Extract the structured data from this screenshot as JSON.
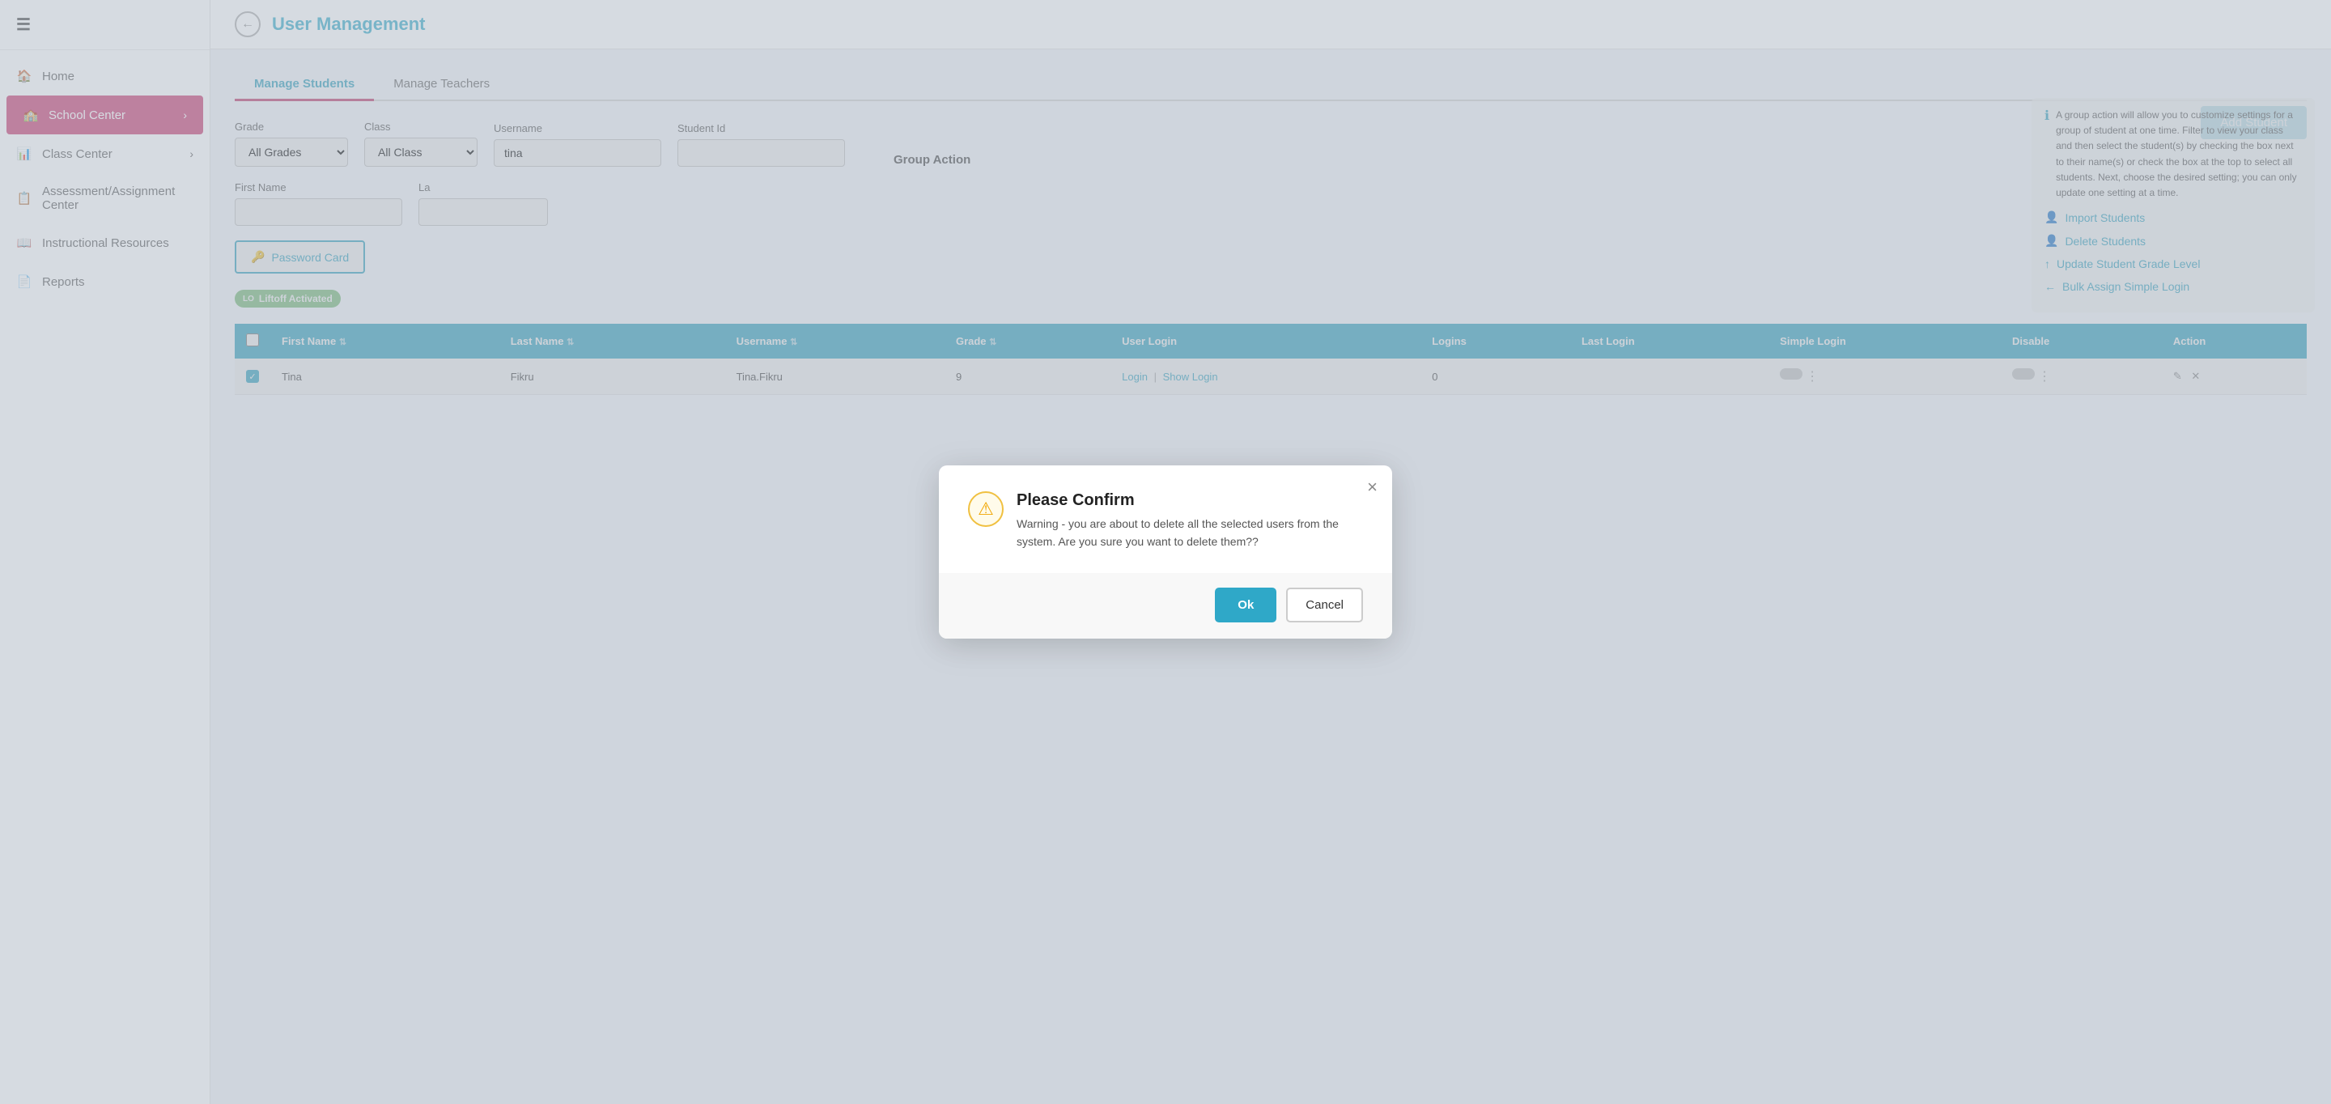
{
  "sidebar": {
    "items": [
      {
        "id": "home",
        "label": "Home",
        "icon": "🏠",
        "active": false
      },
      {
        "id": "school-center",
        "label": "School Center",
        "icon": "🏫",
        "active": true,
        "hasChevron": true
      },
      {
        "id": "class-center",
        "label": "Class Center",
        "icon": "📊",
        "active": false,
        "hasChevron": true
      },
      {
        "id": "assessment",
        "label": "Assessment/Assignment Center",
        "icon": "📋",
        "active": false
      },
      {
        "id": "instructional-resources",
        "label": "Instructional Resources",
        "icon": "📖",
        "active": false
      },
      {
        "id": "reports",
        "label": "Reports",
        "icon": "📄",
        "active": false
      }
    ]
  },
  "page": {
    "title": "User Management",
    "back_label": "←"
  },
  "tabs": [
    {
      "id": "manage-students",
      "label": "Manage Students",
      "active": true
    },
    {
      "id": "manage-teachers",
      "label": "Manage Teachers",
      "active": false
    }
  ],
  "add_student_btn": "Add Student",
  "filters": {
    "grade_label": "Grade",
    "grade_placeholder": "All Grades",
    "class_label": "Class",
    "class_placeholder": "All Class",
    "username_label": "Username",
    "username_value": "tina",
    "student_id_label": "Student Id",
    "student_id_value": "",
    "first_name_label": "First Name",
    "first_name_value": "",
    "last_name_label": "La"
  },
  "action_buttons": [
    {
      "id": "password-card",
      "label": "Password Card",
      "icon": "🔑"
    }
  ],
  "group_action": {
    "title": "Group Action",
    "info": "A group action will allow you to customize settings for a group of student at one time. Filter to view your class and then select the student(s) by checking the box next to their name(s) or check the box at the top to select all students. Next, choose the desired setting; you can only update one setting at a time.",
    "links": [
      {
        "id": "import-students",
        "label": "Import Students",
        "icon": "👤"
      },
      {
        "id": "delete-students",
        "label": "Delete Students",
        "icon": "👤"
      },
      {
        "id": "update-grade",
        "label": "Update Student Grade Level",
        "icon": "↑"
      },
      {
        "id": "bulk-assign",
        "label": "Bulk Assign Simple Login",
        "icon": "←"
      }
    ]
  },
  "liftoff_badge": "Liftoff Activated",
  "table": {
    "headers": [
      {
        "id": "checkbox",
        "label": ""
      },
      {
        "id": "first-name",
        "label": "First Name"
      },
      {
        "id": "last-name",
        "label": "Last Name"
      },
      {
        "id": "username",
        "label": "Username"
      },
      {
        "id": "grade",
        "label": "Grade"
      },
      {
        "id": "user-login",
        "label": "User Login"
      },
      {
        "id": "logins",
        "label": "Logins"
      },
      {
        "id": "last-login",
        "label": "Last Login"
      },
      {
        "id": "simple-login",
        "label": "Simple Login"
      },
      {
        "id": "disable",
        "label": "Disable"
      },
      {
        "id": "action",
        "label": "Action"
      }
    ],
    "rows": [
      {
        "checked": true,
        "first_name": "Tina",
        "last_name": "Fikru",
        "username": "Tina.Fikru",
        "grade": "9",
        "login_label": "Login",
        "show_login_label": "Show Login",
        "logins": "0",
        "last_login": "",
        "simple_login": "",
        "disable": "",
        "action": ""
      }
    ]
  },
  "dialog": {
    "title": "Please Confirm",
    "icon": "⚠",
    "message": "Warning - you are about to delete all the selected users from the system. Are you sure you want to delete them??",
    "ok_label": "Ok",
    "cancel_label": "Cancel",
    "close_label": "×"
  }
}
